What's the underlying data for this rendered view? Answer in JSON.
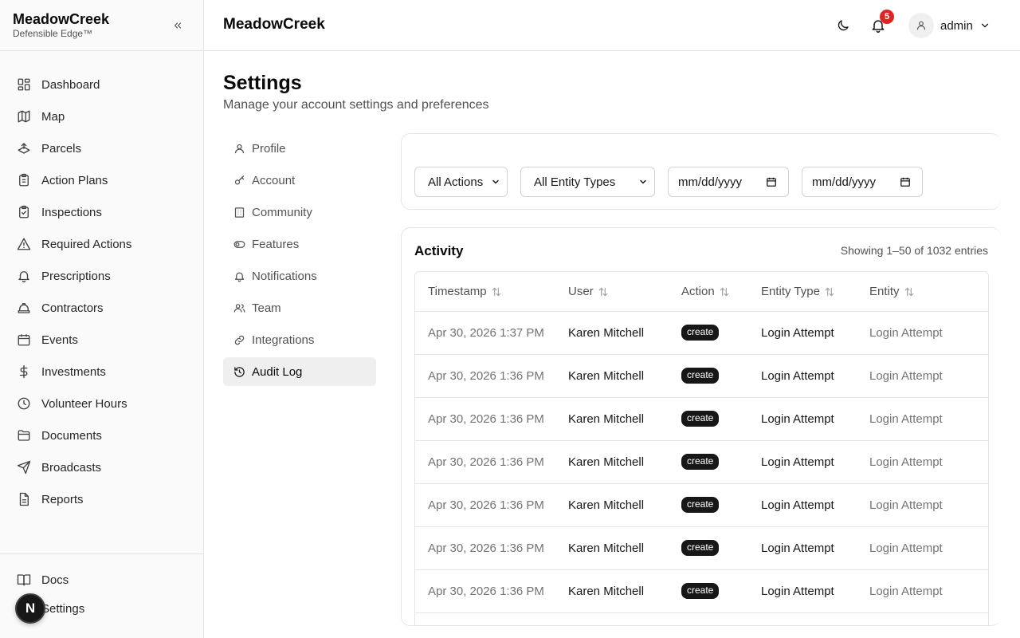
{
  "brand": {
    "name": "MeadowCreek",
    "tagline": "Defensible Edge™"
  },
  "sidebar": {
    "items": [
      {
        "label": "Dashboard",
        "icon": "dashboard-icon"
      },
      {
        "label": "Map",
        "icon": "map-icon"
      },
      {
        "label": "Parcels",
        "icon": "parcels-icon"
      },
      {
        "label": "Action Plans",
        "icon": "clipboard-icon"
      },
      {
        "label": "Inspections",
        "icon": "clipboard-check-icon"
      },
      {
        "label": "Required Actions",
        "icon": "warning-icon"
      },
      {
        "label": "Prescriptions",
        "icon": "bell-icon"
      },
      {
        "label": "Contractors",
        "icon": "hard-hat-icon"
      },
      {
        "label": "Events",
        "icon": "calendar-icon"
      },
      {
        "label": "Investments",
        "icon": "dollar-icon"
      },
      {
        "label": "Volunteer Hours",
        "icon": "clock-icon"
      },
      {
        "label": "Documents",
        "icon": "folder-icon"
      },
      {
        "label": "Broadcasts",
        "icon": "send-icon"
      },
      {
        "label": "Reports",
        "icon": "report-icon"
      }
    ],
    "footer": [
      {
        "label": "Docs",
        "icon": "book-icon"
      },
      {
        "label": "Settings",
        "icon": "gear-icon"
      }
    ],
    "floating_badge": "N"
  },
  "header": {
    "title": "MeadowCreek",
    "notification_count": "5",
    "user": "admin"
  },
  "page": {
    "title": "Settings",
    "subtitle": "Manage your account settings and preferences"
  },
  "settings_nav": [
    {
      "label": "Profile",
      "icon": "user-icon"
    },
    {
      "label": "Account",
      "icon": "key-icon"
    },
    {
      "label": "Community",
      "icon": "building-icon"
    },
    {
      "label": "Features",
      "icon": "toggle-icon"
    },
    {
      "label": "Notifications",
      "icon": "bell-icon"
    },
    {
      "label": "Team",
      "icon": "users-icon"
    },
    {
      "label": "Integrations",
      "icon": "link-icon"
    },
    {
      "label": "Audit Log",
      "icon": "history-icon",
      "active": true
    }
  ],
  "filters": {
    "action": "All Actions",
    "entity_type": "All Entity Types",
    "date_from": "mm/dd/yyyy",
    "date_to": "mm/dd/yyyy"
  },
  "activity": {
    "title": "Activity",
    "count_text": "Showing 1–50 of 1032 entries",
    "columns": [
      "Timestamp",
      "User",
      "Action",
      "Entity Type",
      "Entity"
    ],
    "rows": [
      {
        "timestamp": "Apr 30, 2026 1:37 PM",
        "user": "Karen Mitchell",
        "action": "create",
        "entity_type": "Login Attempt",
        "entity": "Login Attempt"
      },
      {
        "timestamp": "Apr 30, 2026 1:36 PM",
        "user": "Karen Mitchell",
        "action": "create",
        "entity_type": "Login Attempt",
        "entity": "Login Attempt"
      },
      {
        "timestamp": "Apr 30, 2026 1:36 PM",
        "user": "Karen Mitchell",
        "action": "create",
        "entity_type": "Login Attempt",
        "entity": "Login Attempt"
      },
      {
        "timestamp": "Apr 30, 2026 1:36 PM",
        "user": "Karen Mitchell",
        "action": "create",
        "entity_type": "Login Attempt",
        "entity": "Login Attempt"
      },
      {
        "timestamp": "Apr 30, 2026 1:36 PM",
        "user": "Karen Mitchell",
        "action": "create",
        "entity_type": "Login Attempt",
        "entity": "Login Attempt"
      },
      {
        "timestamp": "Apr 30, 2026 1:36 PM",
        "user": "Karen Mitchell",
        "action": "create",
        "entity_type": "Login Attempt",
        "entity": "Login Attempt"
      },
      {
        "timestamp": "Apr 30, 2026 1:36 PM",
        "user": "Karen Mitchell",
        "action": "create",
        "entity_type": "Login Attempt",
        "entity": "Login Attempt"
      }
    ]
  },
  "colors": {
    "accent": "#171717",
    "notification": "#dc2626",
    "border": "#e5e5e5",
    "muted_text": "#737373"
  }
}
